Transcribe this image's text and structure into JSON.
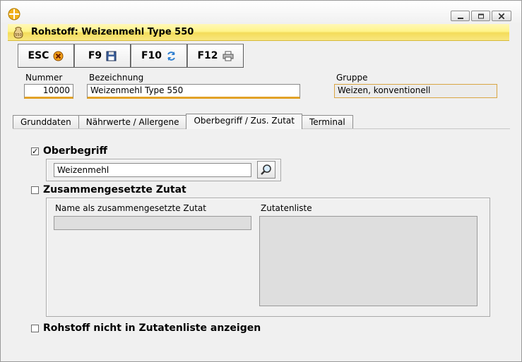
{
  "caption": {
    "title": "Rohstoff: Weizenmehl Type 550",
    "icon": "flour-sack-icon"
  },
  "window_controls": {
    "minimize_icon": "minimize-icon",
    "maximize_icon": "maximize-icon",
    "close_icon": "close-icon"
  },
  "toolbar": [
    {
      "key": "ESC",
      "icon": "cancel-icon"
    },
    {
      "key": "F9",
      "icon": "floppy-disk-icon"
    },
    {
      "key": "F10",
      "icon": "refresh-icon"
    },
    {
      "key": "F12",
      "icon": "printer-icon"
    }
  ],
  "fields": {
    "nummer": {
      "label": "Nummer",
      "value": "10000"
    },
    "bezeichnung": {
      "label": "Bezeichnung",
      "value": "Weizenmehl Type 550"
    },
    "gruppe": {
      "label": "Gruppe",
      "value": "Weizen, konventionell"
    }
  },
  "tabs": [
    {
      "label": "Grunddaten",
      "active": false
    },
    {
      "label": "Nährwerte / Allergene",
      "active": false
    },
    {
      "label": "Oberbegriff / Zus. Zutat",
      "active": true
    },
    {
      "label": "Terminal",
      "active": false
    }
  ],
  "oberbegriff": {
    "label": "Oberbegriff",
    "checked": true,
    "value": "Weizenmehl",
    "search_icon": "magnifier-icon"
  },
  "zusammengesetzt": {
    "label": "Zusammengesetzte Zutat",
    "checked": false,
    "name_label": "Name als zusammengesetzte Zutat",
    "name_value": "",
    "liste_label": "Zutatenliste"
  },
  "nicht_anzeigen": {
    "label": "Rohstoff nicht in Zutatenliste anzeigen",
    "checked": false
  },
  "colors": {
    "caption_bar": "#f8e780",
    "field_underline": "#e2a227"
  }
}
